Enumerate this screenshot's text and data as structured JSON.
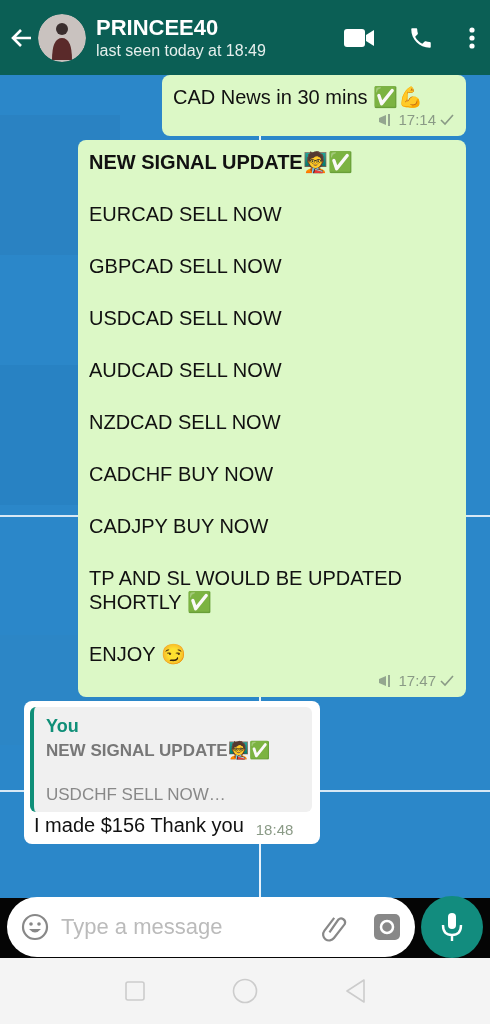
{
  "header": {
    "title": "PRINCEE40",
    "status": "last seen today at 18:49"
  },
  "messages": [
    {
      "kind": "outgoing",
      "lines": [
        "CAD News in 30 mins ✅💪"
      ],
      "time": "17:14",
      "broadcast": true,
      "sent": true
    },
    {
      "kind": "outgoing",
      "title": "NEW SIGNAL UPDATE🧑‍🏫✅",
      "lines": [
        "EURCAD SELL NOW",
        "GBPCAD SELL NOW",
        "USDCAD SELL NOW",
        "AUDCAD SELL NOW",
        "NZDCAD SELL NOW",
        "CADCHF BUY NOW",
        "CADJPY BUY NOW",
        "TP AND SL WOULD BE UPDATED SHORTLY ✅",
        "ENJOY 😏"
      ],
      "time": "17:47",
      "broadcast": true,
      "sent": true
    },
    {
      "kind": "incoming",
      "quote": {
        "author": "You",
        "title": "NEW SIGNAL UPDATE🧑‍🏫✅",
        "preview": "USDCHF SELL NOW…"
      },
      "lines": [
        "I made $156 Thank you"
      ],
      "time": "18:48",
      "broadcast": false
    }
  ],
  "composer": {
    "placeholder": "Type a message"
  }
}
